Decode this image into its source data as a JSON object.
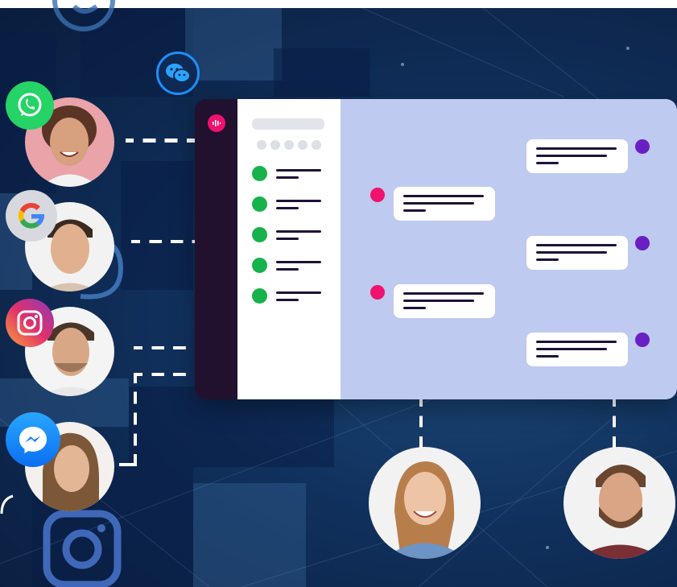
{
  "colors": {
    "background": "#0e2448",
    "rail": "#22112e",
    "chat_panel": "#bfcaf0",
    "online_green": "#17b24b",
    "incoming_pink": "#f0126e",
    "outgoing_purple": "#6a1fc2",
    "text_line": "#1f1236"
  },
  "icons": {
    "whatsapp": "whatsapp-icon",
    "google": "google-icon",
    "instagram": "instagram-icon",
    "messenger": "messenger-icon",
    "wechat": "wechat-icon",
    "app_logo": "app-logo-icon"
  },
  "contacts": [
    {
      "status": "online"
    },
    {
      "status": "online"
    },
    {
      "status": "online"
    },
    {
      "status": "online"
    },
    {
      "status": "online"
    }
  ],
  "messages": [
    {
      "direction": "outgoing"
    },
    {
      "direction": "incoming"
    },
    {
      "direction": "outgoing"
    },
    {
      "direction": "incoming"
    },
    {
      "direction": "outgoing"
    }
  ]
}
